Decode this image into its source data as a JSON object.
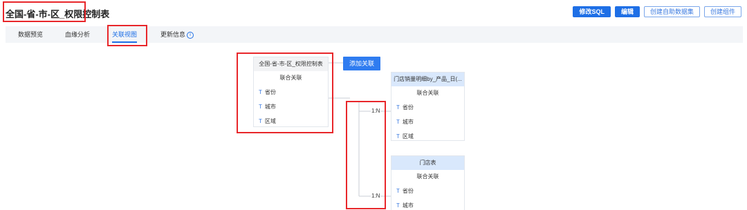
{
  "header": {
    "title": "全国-省-市-区_权限控制表",
    "buttons": {
      "edit_sql": "修改SQL",
      "edit": "编辑",
      "create_self_service": "创建自助数据集",
      "create_component": "创建组件"
    }
  },
  "tabs": {
    "preview": "数据预览",
    "lineage": "血缘分析",
    "relation": "关联视图",
    "update": "更新信息",
    "info_icon": "i"
  },
  "main_table": {
    "title": "全国-省-市-区_权限控制表",
    "join_label": "联合关联",
    "fields": [
      "省份",
      "城市",
      "区域"
    ]
  },
  "add_relation_button": "添加关联",
  "field_type_icon": "T",
  "related_tables": [
    {
      "title": "门店销量明细by_产品_日(...",
      "join_label": "联合关联",
      "relation": "1:N",
      "fields": [
        "省份",
        "城市",
        "区域"
      ]
    },
    {
      "title": "门店表",
      "join_label": "联合关联",
      "relation": "1:N",
      "fields": [
        "省份",
        "城市"
      ]
    }
  ],
  "colors": {
    "primary": "#1e6fe6",
    "highlight": "#e8262a",
    "node_header_blue": "#d9e8fc"
  },
  "icons": [
    "info-icon",
    "text-field-icon"
  ]
}
